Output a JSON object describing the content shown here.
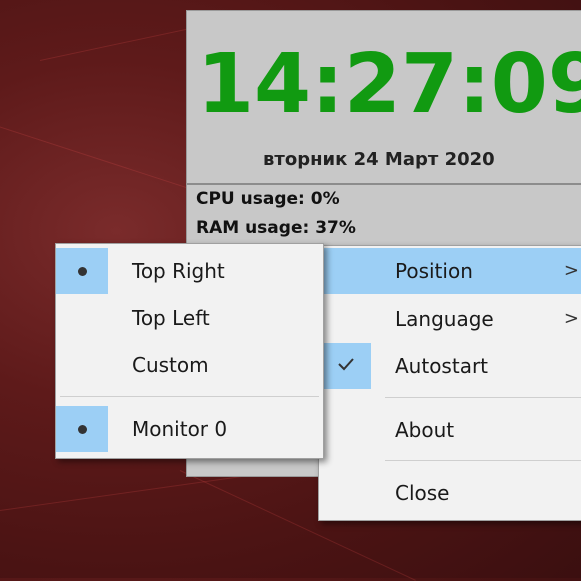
{
  "clock_widget": {
    "time": "14:27:09",
    "date": "вторник 24 Март 2020",
    "cpu_usage": "CPU usage: 0%",
    "ram_usage": "RAM usage: 37%",
    "time_color": "#119a11"
  },
  "main_menu": {
    "items": [
      {
        "label": "Position",
        "has_submenu": true,
        "highlighted": true
      },
      {
        "label": "Language",
        "has_submenu": true
      },
      {
        "label": "Autostart",
        "checked": true
      },
      {
        "label": "About"
      },
      {
        "label": "Close"
      }
    ],
    "submenu_arrow": ">",
    "highlight_color": "#9ccff5"
  },
  "position_submenu": {
    "items": [
      {
        "label": "Top Right",
        "selected": true
      },
      {
        "label": "Top Left"
      },
      {
        "label": "Custom"
      },
      {
        "label": "Monitor 0",
        "selected": true
      }
    ]
  }
}
